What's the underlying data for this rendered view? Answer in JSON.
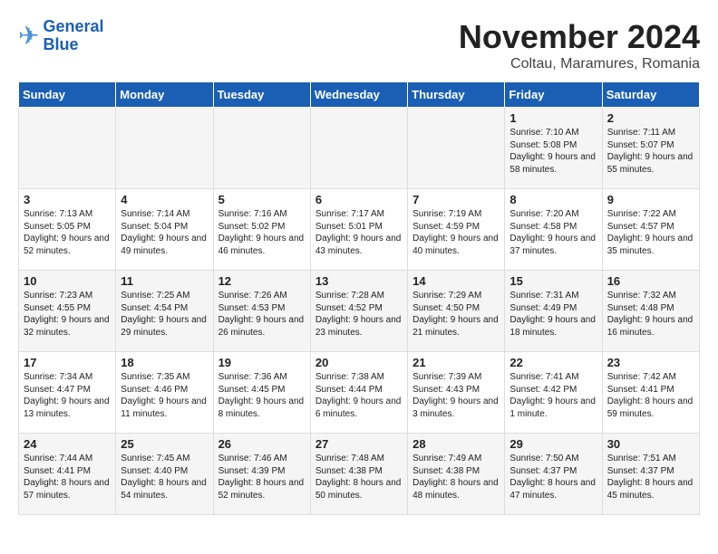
{
  "logo": {
    "line1": "General",
    "line2": "Blue"
  },
  "title": "November 2024",
  "subtitle": "Coltau, Maramures, Romania",
  "days_of_week": [
    "Sunday",
    "Monday",
    "Tuesday",
    "Wednesday",
    "Thursday",
    "Friday",
    "Saturday"
  ],
  "weeks": [
    [
      {
        "day": "",
        "info": ""
      },
      {
        "day": "",
        "info": ""
      },
      {
        "day": "",
        "info": ""
      },
      {
        "day": "",
        "info": ""
      },
      {
        "day": "",
        "info": ""
      },
      {
        "day": "1",
        "info": "Sunrise: 7:10 AM\nSunset: 5:08 PM\nDaylight: 9 hours and 58 minutes."
      },
      {
        "day": "2",
        "info": "Sunrise: 7:11 AM\nSunset: 5:07 PM\nDaylight: 9 hours and 55 minutes."
      }
    ],
    [
      {
        "day": "3",
        "info": "Sunrise: 7:13 AM\nSunset: 5:05 PM\nDaylight: 9 hours and 52 minutes."
      },
      {
        "day": "4",
        "info": "Sunrise: 7:14 AM\nSunset: 5:04 PM\nDaylight: 9 hours and 49 minutes."
      },
      {
        "day": "5",
        "info": "Sunrise: 7:16 AM\nSunset: 5:02 PM\nDaylight: 9 hours and 46 minutes."
      },
      {
        "day": "6",
        "info": "Sunrise: 7:17 AM\nSunset: 5:01 PM\nDaylight: 9 hours and 43 minutes."
      },
      {
        "day": "7",
        "info": "Sunrise: 7:19 AM\nSunset: 4:59 PM\nDaylight: 9 hours and 40 minutes."
      },
      {
        "day": "8",
        "info": "Sunrise: 7:20 AM\nSunset: 4:58 PM\nDaylight: 9 hours and 37 minutes."
      },
      {
        "day": "9",
        "info": "Sunrise: 7:22 AM\nSunset: 4:57 PM\nDaylight: 9 hours and 35 minutes."
      }
    ],
    [
      {
        "day": "10",
        "info": "Sunrise: 7:23 AM\nSunset: 4:55 PM\nDaylight: 9 hours and 32 minutes."
      },
      {
        "day": "11",
        "info": "Sunrise: 7:25 AM\nSunset: 4:54 PM\nDaylight: 9 hours and 29 minutes."
      },
      {
        "day": "12",
        "info": "Sunrise: 7:26 AM\nSunset: 4:53 PM\nDaylight: 9 hours and 26 minutes."
      },
      {
        "day": "13",
        "info": "Sunrise: 7:28 AM\nSunset: 4:52 PM\nDaylight: 9 hours and 23 minutes."
      },
      {
        "day": "14",
        "info": "Sunrise: 7:29 AM\nSunset: 4:50 PM\nDaylight: 9 hours and 21 minutes."
      },
      {
        "day": "15",
        "info": "Sunrise: 7:31 AM\nSunset: 4:49 PM\nDaylight: 9 hours and 18 minutes."
      },
      {
        "day": "16",
        "info": "Sunrise: 7:32 AM\nSunset: 4:48 PM\nDaylight: 9 hours and 16 minutes."
      }
    ],
    [
      {
        "day": "17",
        "info": "Sunrise: 7:34 AM\nSunset: 4:47 PM\nDaylight: 9 hours and 13 minutes."
      },
      {
        "day": "18",
        "info": "Sunrise: 7:35 AM\nSunset: 4:46 PM\nDaylight: 9 hours and 11 minutes."
      },
      {
        "day": "19",
        "info": "Sunrise: 7:36 AM\nSunset: 4:45 PM\nDaylight: 9 hours and 8 minutes."
      },
      {
        "day": "20",
        "info": "Sunrise: 7:38 AM\nSunset: 4:44 PM\nDaylight: 9 hours and 6 minutes."
      },
      {
        "day": "21",
        "info": "Sunrise: 7:39 AM\nSunset: 4:43 PM\nDaylight: 9 hours and 3 minutes."
      },
      {
        "day": "22",
        "info": "Sunrise: 7:41 AM\nSunset: 4:42 PM\nDaylight: 9 hours and 1 minute."
      },
      {
        "day": "23",
        "info": "Sunrise: 7:42 AM\nSunset: 4:41 PM\nDaylight: 8 hours and 59 minutes."
      }
    ],
    [
      {
        "day": "24",
        "info": "Sunrise: 7:44 AM\nSunset: 4:41 PM\nDaylight: 8 hours and 57 minutes."
      },
      {
        "day": "25",
        "info": "Sunrise: 7:45 AM\nSunset: 4:40 PM\nDaylight: 8 hours and 54 minutes."
      },
      {
        "day": "26",
        "info": "Sunrise: 7:46 AM\nSunset: 4:39 PM\nDaylight: 8 hours and 52 minutes."
      },
      {
        "day": "27",
        "info": "Sunrise: 7:48 AM\nSunset: 4:38 PM\nDaylight: 8 hours and 50 minutes."
      },
      {
        "day": "28",
        "info": "Sunrise: 7:49 AM\nSunset: 4:38 PM\nDaylight: 8 hours and 48 minutes."
      },
      {
        "day": "29",
        "info": "Sunrise: 7:50 AM\nSunset: 4:37 PM\nDaylight: 8 hours and 47 minutes."
      },
      {
        "day": "30",
        "info": "Sunrise: 7:51 AM\nSunset: 4:37 PM\nDaylight: 8 hours and 45 minutes."
      }
    ]
  ]
}
